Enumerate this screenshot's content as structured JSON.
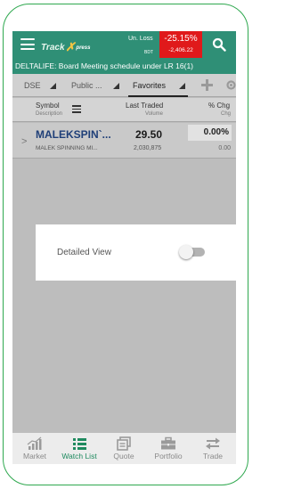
{
  "header": {
    "logo_main": "Track",
    "logo_sub": "press",
    "loss_label": "Un. Loss",
    "loss_pct": "-25.15%",
    "bdt_label": "BDT",
    "loss_value": "-2,406.22"
  },
  "ticker": "DELTALIFE: Board Meeting schedule under LR 16(1)",
  "tabs": [
    {
      "label": "DSE"
    },
    {
      "label": "Public ..."
    },
    {
      "label": "Favorites"
    }
  ],
  "columns": {
    "symbol": "Symbol",
    "symbol_sub": "Description",
    "last": "Last Traded",
    "last_sub": "Volume",
    "chg": "% Chg",
    "chg_sub": "Chg"
  },
  "rows": [
    {
      "symbol": "MALEKSPIN`...",
      "description": "MALEK SPINNING MI...",
      "price": "29.50",
      "volume": "2,030,875",
      "pct": "0.00%",
      "chg": "0.00"
    }
  ],
  "dialog": {
    "label": "Detailed View",
    "toggle_on": false
  },
  "nav": [
    {
      "label": "Market",
      "icon": "market-chart-icon"
    },
    {
      "label": "Watch List",
      "icon": "list-icon"
    },
    {
      "label": "Quote",
      "icon": "quote-icon"
    },
    {
      "label": "Portfolio",
      "icon": "briefcase-icon"
    },
    {
      "label": "Trade",
      "icon": "arrows-icon"
    }
  ],
  "colors": {
    "header": "#2f8f76",
    "loss_bg": "#e0191b",
    "active_nav": "#1f8a5f",
    "symbol": "#1f3f78"
  }
}
